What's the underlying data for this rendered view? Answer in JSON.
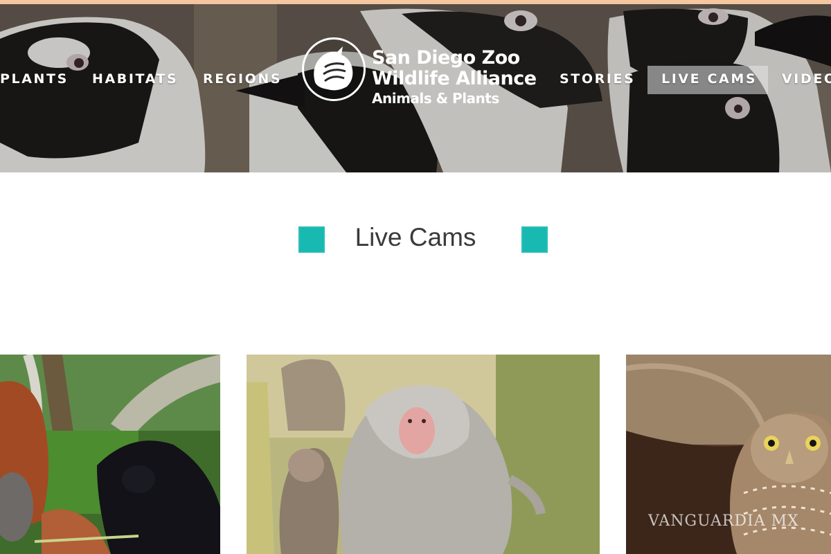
{
  "nav": {
    "items": [
      "PLANTS",
      "HABITATS",
      "REGIONS",
      "STORIES",
      "LIVE CAMS",
      "VIDEO"
    ],
    "active": "LIVE CAMS"
  },
  "logo": {
    "line1": "San Diego Zoo",
    "line2": "Wildlife Alliance",
    "line3": "Animals & Plants"
  },
  "section": {
    "title": "Live Cams"
  },
  "cards": [
    {
      "subject": "orangutan and siamang"
    },
    {
      "subject": "baboons"
    },
    {
      "subject": "burrowing owl"
    }
  ],
  "watermark": "VANGUARDIA MX",
  "colors": {
    "accent_teal": "#17b9b1",
    "top_strip": "#f4c7a0",
    "title_text": "#3a3a3a"
  }
}
